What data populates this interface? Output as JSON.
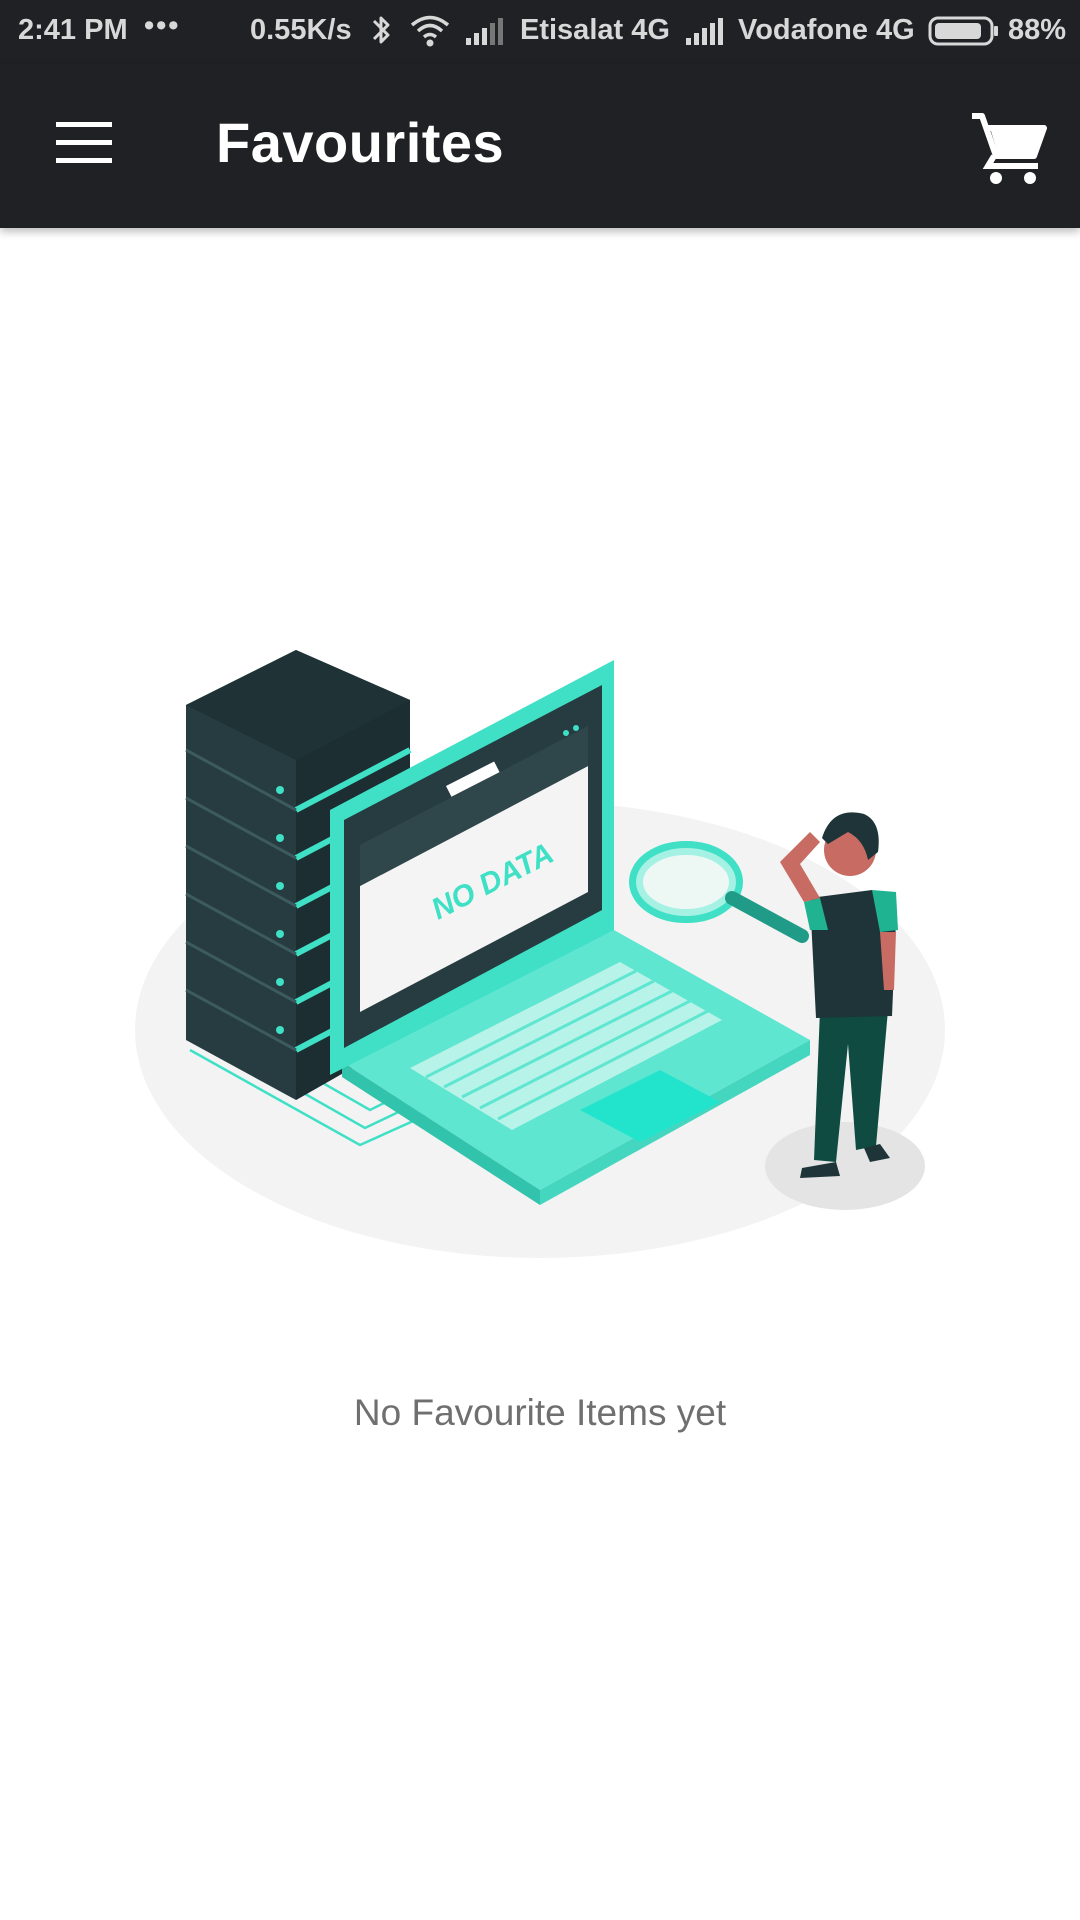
{
  "status_bar": {
    "time": "2:41 PM",
    "dots": "•••",
    "speed": "0.55K/s",
    "bluetooth_icon": "bluetooth-icon",
    "wifi_icon": "wifi-icon",
    "carrier1": "Etisalat 4G",
    "carrier2": "Vodafone 4G",
    "battery_percent": "88%",
    "battery_level": 0.88
  },
  "app_bar": {
    "title": "Favourites",
    "menu_icon": "hamburger-menu-icon",
    "cart_icon": "shopping-cart-icon"
  },
  "empty_state": {
    "illustration_text": "NO DATA",
    "message": "No Favourite Items yet"
  },
  "colors": {
    "app_bar": "#202124",
    "accent": "#3fe0c5",
    "dark_teal": "#1f3b3f"
  }
}
